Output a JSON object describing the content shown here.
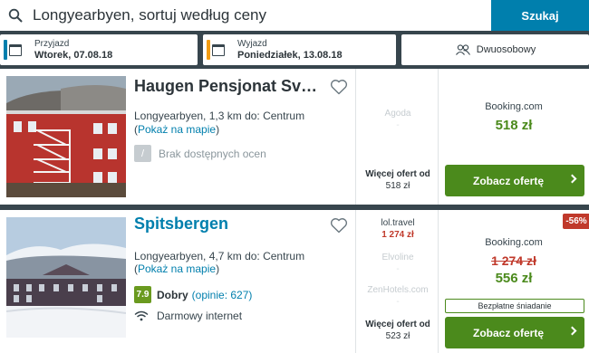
{
  "search": {
    "query": "Longyearbyen, sortuj według ceny",
    "button_label": "Szukaj"
  },
  "dates": {
    "checkin_label": "Przyjazd",
    "checkin_value": "Wtorek, 07.08.18",
    "checkout_label": "Wyjazd",
    "checkout_value": "Poniedziałek, 13.08.18",
    "room_label": "Dwuosobowy"
  },
  "colors": {
    "accent_blue": "#007fad",
    "checkout_accent": "#f39c12",
    "cta_green": "#4b8a1c",
    "discount_red": "#c0392b"
  },
  "hotels": [
    {
      "name": "Haugen Pensjonat Svalbard",
      "location": "Longyearbyen, 1,3 km do: Centrum",
      "map_open": "(",
      "map_link": "Pokaż na mapie",
      "map_close": ")",
      "rating_badge": "/",
      "rating_text": "Brak dostępnych ocen",
      "offers": [
        {
          "name": "Agoda",
          "price": "-"
        }
      ],
      "more_offers_label": "Więcej ofert od",
      "more_offers_price": "518 zł",
      "deal_provider": "Booking.com",
      "deal_price": "518 zł",
      "cta_label": "Zobacz ofertę"
    },
    {
      "name": "Spitsbergen",
      "location": "Longyearbyen, 4,7 km do: Centrum",
      "map_open": "(",
      "map_link": "Pokaż na mapie",
      "map_close": ")",
      "rating_score": "7.9",
      "rating_word": "Dobry",
      "rating_count": "(opinie: 627)",
      "amenity": "Darmowy internet",
      "offers": [
        {
          "name": "lol.travel",
          "price": "1 274 zł"
        },
        {
          "name": "Elvoline",
          "price": "-"
        },
        {
          "name": "ZenHotels.com",
          "price": "-"
        }
      ],
      "more_offers_label": "Więcej ofert od",
      "more_offers_price": "523 zł",
      "discount": "-56%",
      "deal_provider": "Booking.com",
      "deal_old_price": "1 274 zł",
      "deal_price": "556 zł",
      "breakfast_badge": "Bezpłatne śniadanie",
      "cta_label": "Zobacz ofertę"
    }
  ]
}
